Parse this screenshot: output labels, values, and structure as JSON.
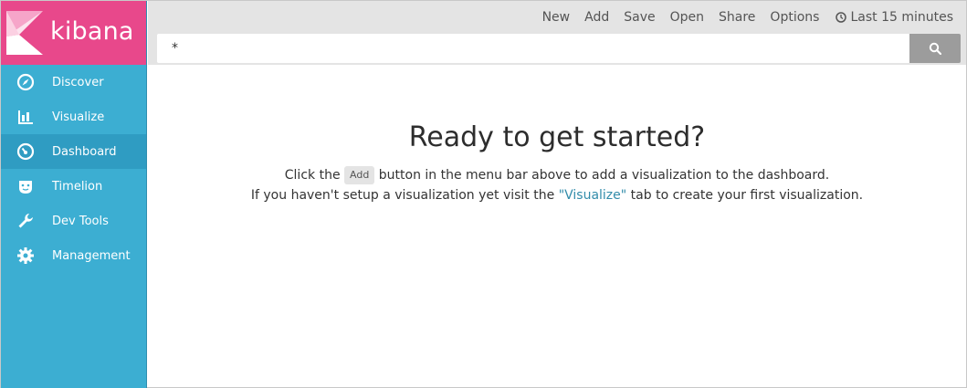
{
  "brand": {
    "name": "kibana"
  },
  "sidebar": {
    "items": [
      {
        "label": "Discover",
        "icon": "compass-icon"
      },
      {
        "label": "Visualize",
        "icon": "bar-chart-icon"
      },
      {
        "label": "Dashboard",
        "icon": "dashboard-icon",
        "active": true
      },
      {
        "label": "Timelion",
        "icon": "timelion-icon"
      },
      {
        "label": "Dev Tools",
        "icon": "wrench-icon"
      },
      {
        "label": "Management",
        "icon": "gear-icon"
      }
    ]
  },
  "topnav": {
    "new_label": "New",
    "add_label": "Add",
    "save_label": "Save",
    "open_label": "Open",
    "share_label": "Share",
    "options_label": "Options",
    "time_label": "Last 15 minutes"
  },
  "query": {
    "value": "*"
  },
  "empty_state": {
    "title": "Ready to get started?",
    "line1_prefix": "Click the",
    "line1_button": "Add",
    "line1_suffix": "button in the menu bar above to add a visualization to the dashboard.",
    "line2_prefix": "If you haven't setup a visualization yet visit the",
    "line2_link": "\"Visualize\"",
    "line2_suffix": "tab to create your first visualization."
  },
  "colors": {
    "sidebar_bg": "#3caed2",
    "sidebar_active": "#2f9cc2",
    "logo_bg": "#e8488b",
    "topbar_bg": "#e4e4e4",
    "link": "#328caa"
  }
}
